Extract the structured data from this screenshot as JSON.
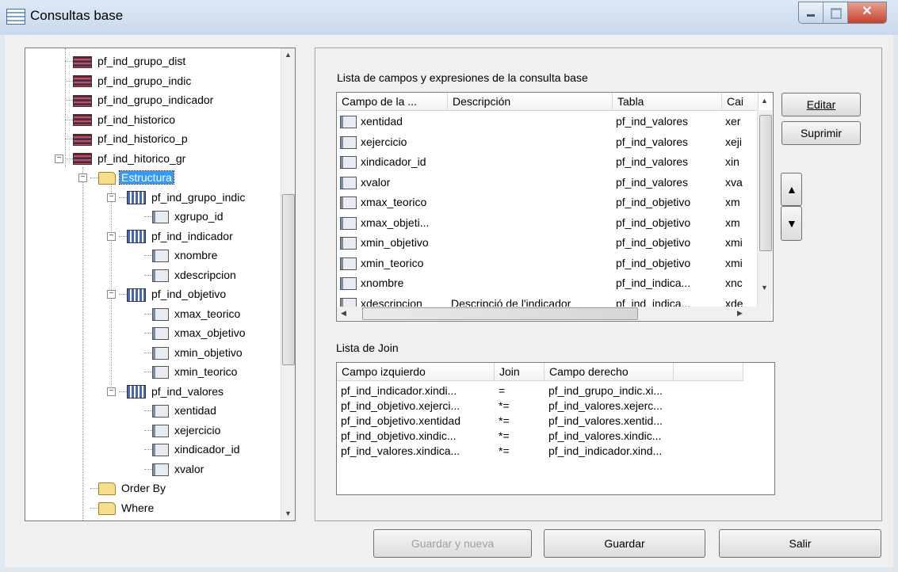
{
  "window": {
    "title": "Consultas base"
  },
  "tree": {
    "items": [
      {
        "label": "pf_ind_grupo_dist",
        "icon": "table-icon"
      },
      {
        "label": "pf_ind_grupo_indic",
        "icon": "table-icon"
      },
      {
        "label": "pf_ind_grupo_indicador",
        "icon": "table-icon"
      },
      {
        "label": "pf_ind_historico",
        "icon": "table-icon"
      },
      {
        "label": "pf_ind_historico_p",
        "icon": "table-icon"
      },
      {
        "label": "pf_ind_hitorico_gr",
        "icon": "table-icon"
      },
      {
        "label": "Estructura",
        "icon": "folder-open-icon",
        "selected": true
      },
      {
        "label": "pf_ind_grupo_indic",
        "icon": "entity-icon"
      },
      {
        "label": "xgrupo_id",
        "icon": "field-icon"
      },
      {
        "label": "pf_ind_indicador",
        "icon": "entity-icon"
      },
      {
        "label": "xnombre",
        "icon": "field-icon"
      },
      {
        "label": "xdescripcion",
        "icon": "field-icon"
      },
      {
        "label": "pf_ind_objetivo",
        "icon": "entity-icon"
      },
      {
        "label": "xmax_teorico",
        "icon": "field-icon"
      },
      {
        "label": "xmax_objetivo",
        "icon": "field-icon"
      },
      {
        "label": "xmin_objetivo",
        "icon": "field-icon"
      },
      {
        "label": "xmin_teorico",
        "icon": "field-icon"
      },
      {
        "label": "pf_ind_valores",
        "icon": "entity-icon"
      },
      {
        "label": "xentidad",
        "icon": "field-icon"
      },
      {
        "label": "xejercicio",
        "icon": "field-icon"
      },
      {
        "label": "xindicador_id",
        "icon": "field-icon"
      },
      {
        "label": "xvalor",
        "icon": "field-icon"
      },
      {
        "label": "Order By",
        "icon": "folder-icon"
      },
      {
        "label": "Where",
        "icon": "folder-icon"
      }
    ]
  },
  "fields": {
    "label": "Lista de campos y expresiones de la consulta base",
    "columns": [
      "Campo de la ...",
      "Descripción",
      "Tabla",
      "Cai"
    ],
    "rows": [
      [
        "xentidad",
        "",
        "pf_ind_valores",
        "xer"
      ],
      [
        "xejercicio",
        "",
        "pf_ind_valores",
        "xeji"
      ],
      [
        "xindicador_id",
        "",
        "pf_ind_valores",
        "xin"
      ],
      [
        "xvalor",
        "",
        "pf_ind_valores",
        "xva"
      ],
      [
        "xmax_teorico",
        "",
        "pf_ind_objetivo",
        "xm"
      ],
      [
        "xmax_objeti...",
        "",
        "pf_ind_objetivo",
        "xm"
      ],
      [
        "xmin_objetivo",
        "",
        "pf_ind_objetivo",
        "xmi"
      ],
      [
        "xmin_teorico",
        "",
        "pf_ind_objetivo",
        "xmi"
      ],
      [
        "xnombre",
        "",
        "pf_ind_indica...",
        "xnc"
      ],
      [
        "xdescripcion",
        "Descripció de l'indicador",
        "pf_ind_indica...",
        "xde"
      ]
    ]
  },
  "joins": {
    "label": "Lista de Join",
    "columns": [
      "Campo izquierdo",
      "Join",
      "Campo derecho"
    ],
    "rows": [
      [
        "pf_ind_indicador.xindi...",
        "=",
        "pf_ind_grupo_indic.xi..."
      ],
      [
        "pf_ind_objetivo.xejerci...",
        "*=",
        "pf_ind_valores.xejerc..."
      ],
      [
        "pf_ind_objetivo.xentidad",
        "*=",
        "pf_ind_valores.xentid..."
      ],
      [
        "pf_ind_objetivo.xindic...",
        "*=",
        "pf_ind_valores.xindic..."
      ],
      [
        "pf_ind_valores.xindica...",
        "*=",
        "pf_ind_indicador.xind..."
      ]
    ]
  },
  "buttons": {
    "edit": "Editar",
    "delete": "Suprimir",
    "save_new": "Guardar y nueva",
    "save": "Guardar",
    "exit": "Salir"
  }
}
